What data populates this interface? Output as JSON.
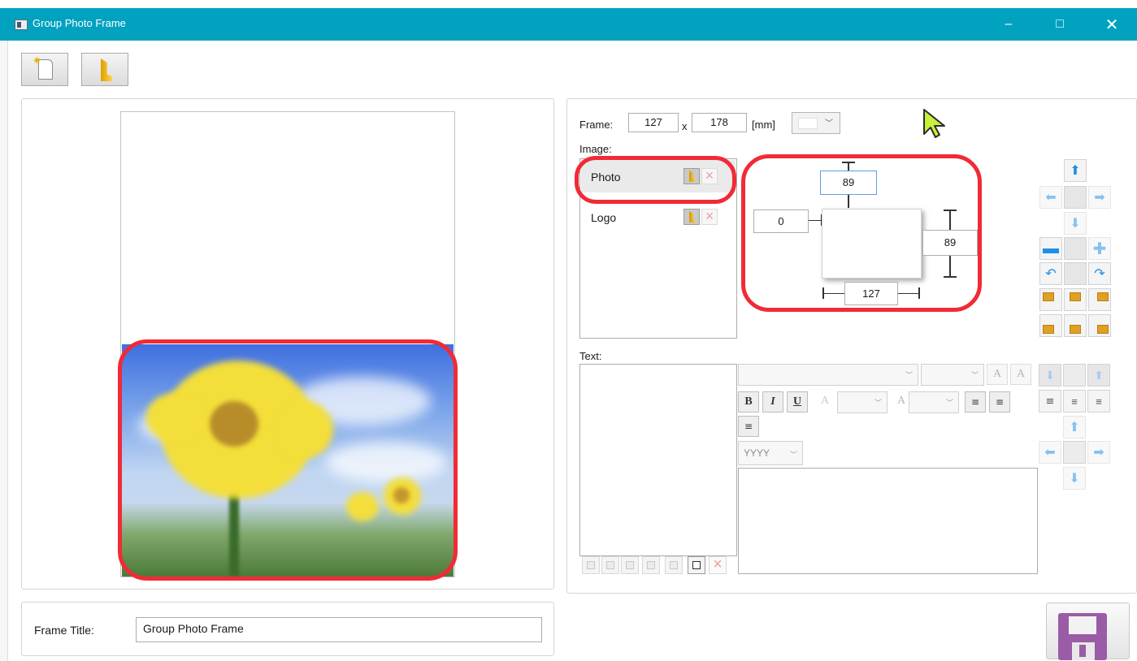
{
  "window": {
    "title": "Group Photo Frame",
    "controls": {
      "minimize": "–",
      "maximize": "□",
      "close": "✕"
    }
  },
  "toolbar": {
    "new_icon": "new-document-icon",
    "open_icon": "open-folder-icon"
  },
  "frame_settings": {
    "label": "Frame:",
    "width": "127",
    "separator": "x",
    "height": "178",
    "unit": "[mm]",
    "color_select_value": "white"
  },
  "image_section": {
    "label": "Image:",
    "items": [
      {
        "label": "Photo",
        "selected": true
      },
      {
        "label": "Logo",
        "selected": false
      }
    ]
  },
  "position": {
    "top": "89",
    "left": "0",
    "right": "89",
    "width": "127"
  },
  "text_section": {
    "label": "Text:",
    "date_format": "YYYY",
    "format_buttons": {
      "bold": "B",
      "italic": "I",
      "underline": "U"
    }
  },
  "footer": {
    "frame_title_label": "Frame Title:",
    "frame_title_value": "Group Photo Frame",
    "save_icon": "floppy-disk-icon"
  },
  "colors": {
    "titlebar": "#00a2c0",
    "highlight": "#f02b36",
    "arrow": "#1e90e8",
    "save_disk": "#9a5ca7"
  }
}
